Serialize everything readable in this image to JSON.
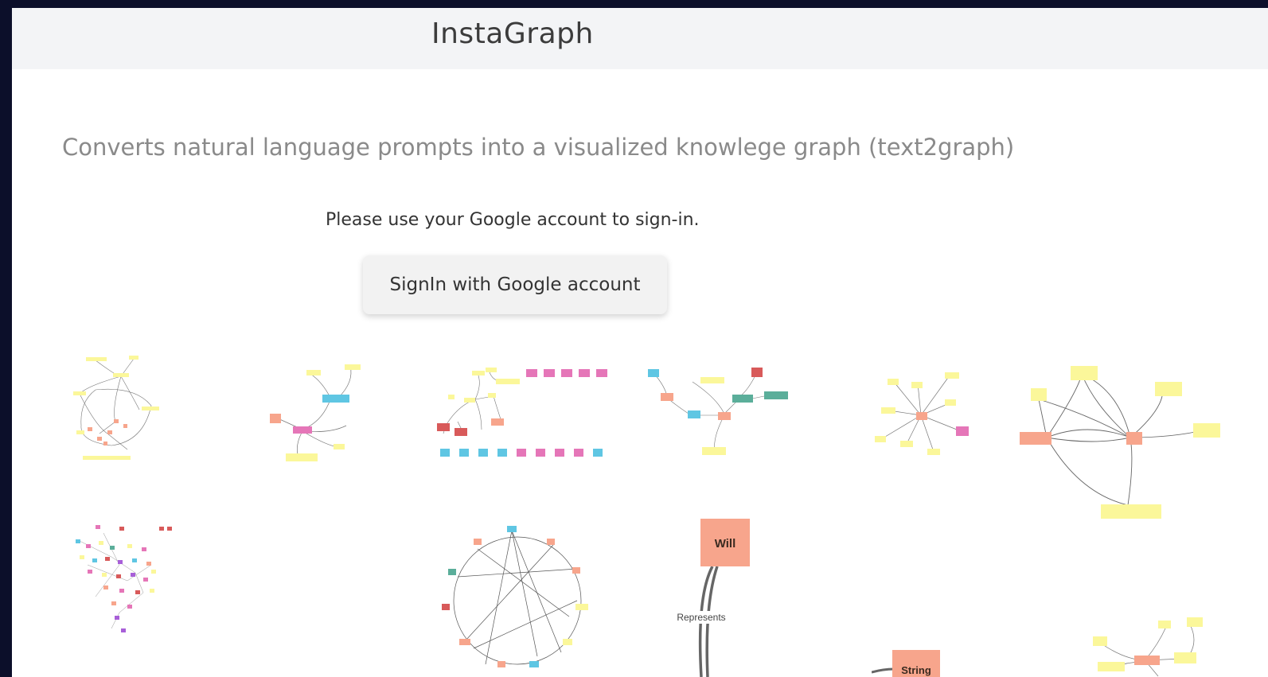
{
  "app": {
    "title": "InstaGraph"
  },
  "main": {
    "subtitle": "Converts natural language prompts into a visualized knowlege graph (text2graph)",
    "signin_message": "Please use your Google account to sign-in.",
    "signin_button": "SignIn with Google account"
  },
  "gallery": {
    "will_label": "Will",
    "represents_label": "Represents",
    "string_label": "String"
  },
  "colors": {
    "background": "#0c0f2a",
    "header": "#f3f4f6",
    "node_yellow": "#fbf79a",
    "node_salmon": "#f7a58c",
    "node_pink": "#e576b8",
    "node_cyan": "#5fc6e3",
    "node_red": "#d85a5a",
    "node_teal": "#5bae9a"
  }
}
